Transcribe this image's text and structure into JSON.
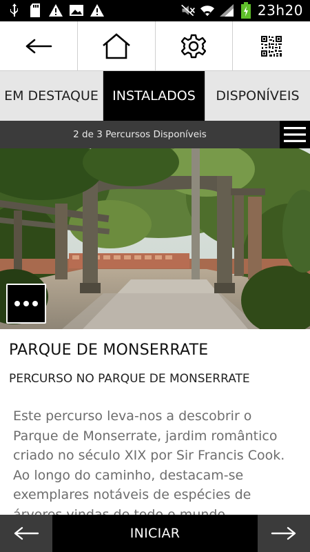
{
  "status_bar": {
    "time": "23h20",
    "icons": [
      "usb-icon",
      "sd-card-icon",
      "warning-icon",
      "image-icon",
      "warning-icon",
      "mute-icon",
      "wifi-icon",
      "signal-icon",
      "battery-charging-icon"
    ]
  },
  "toolbar": {
    "buttons": [
      "back-arrow-icon",
      "home-icon",
      "gear-icon",
      "qr-code-icon"
    ]
  },
  "tabs": [
    {
      "label": "EM DESTAQUE",
      "active": false
    },
    {
      "label": "INSTALADOS",
      "active": true
    },
    {
      "label": "DISPONÍVEIS",
      "active": false
    }
  ],
  "counter": {
    "text": "2 de 3 Percursos Disponíveis"
  },
  "hero": {
    "more_icon": "more-dots-icon"
  },
  "route": {
    "title": "PARQUE DE MONSERRATE",
    "subtitle": "PERCURSO NO PARQUE DE MONSERRATE",
    "description": "Este percurso leva-nos a descobrir o Parque de Monserrate, jardim romântico criado no século XIX por Sir Francis Cook. Ao longo do caminho, destacam-se exemplares notáveis de espécies de árvores vindas de todo o mundo, diferentes habitats que abrigam"
  },
  "bottom_bar": {
    "start_label": "INICIAR",
    "prev_icon": "arrow-left-icon",
    "next_icon": "arrow-right-icon"
  },
  "colors": {
    "active_tab": "#000000",
    "inactive_tab": "#e6e6e6",
    "counter_bar": "#3b3b3b",
    "description_text": "#6d6d6d"
  }
}
